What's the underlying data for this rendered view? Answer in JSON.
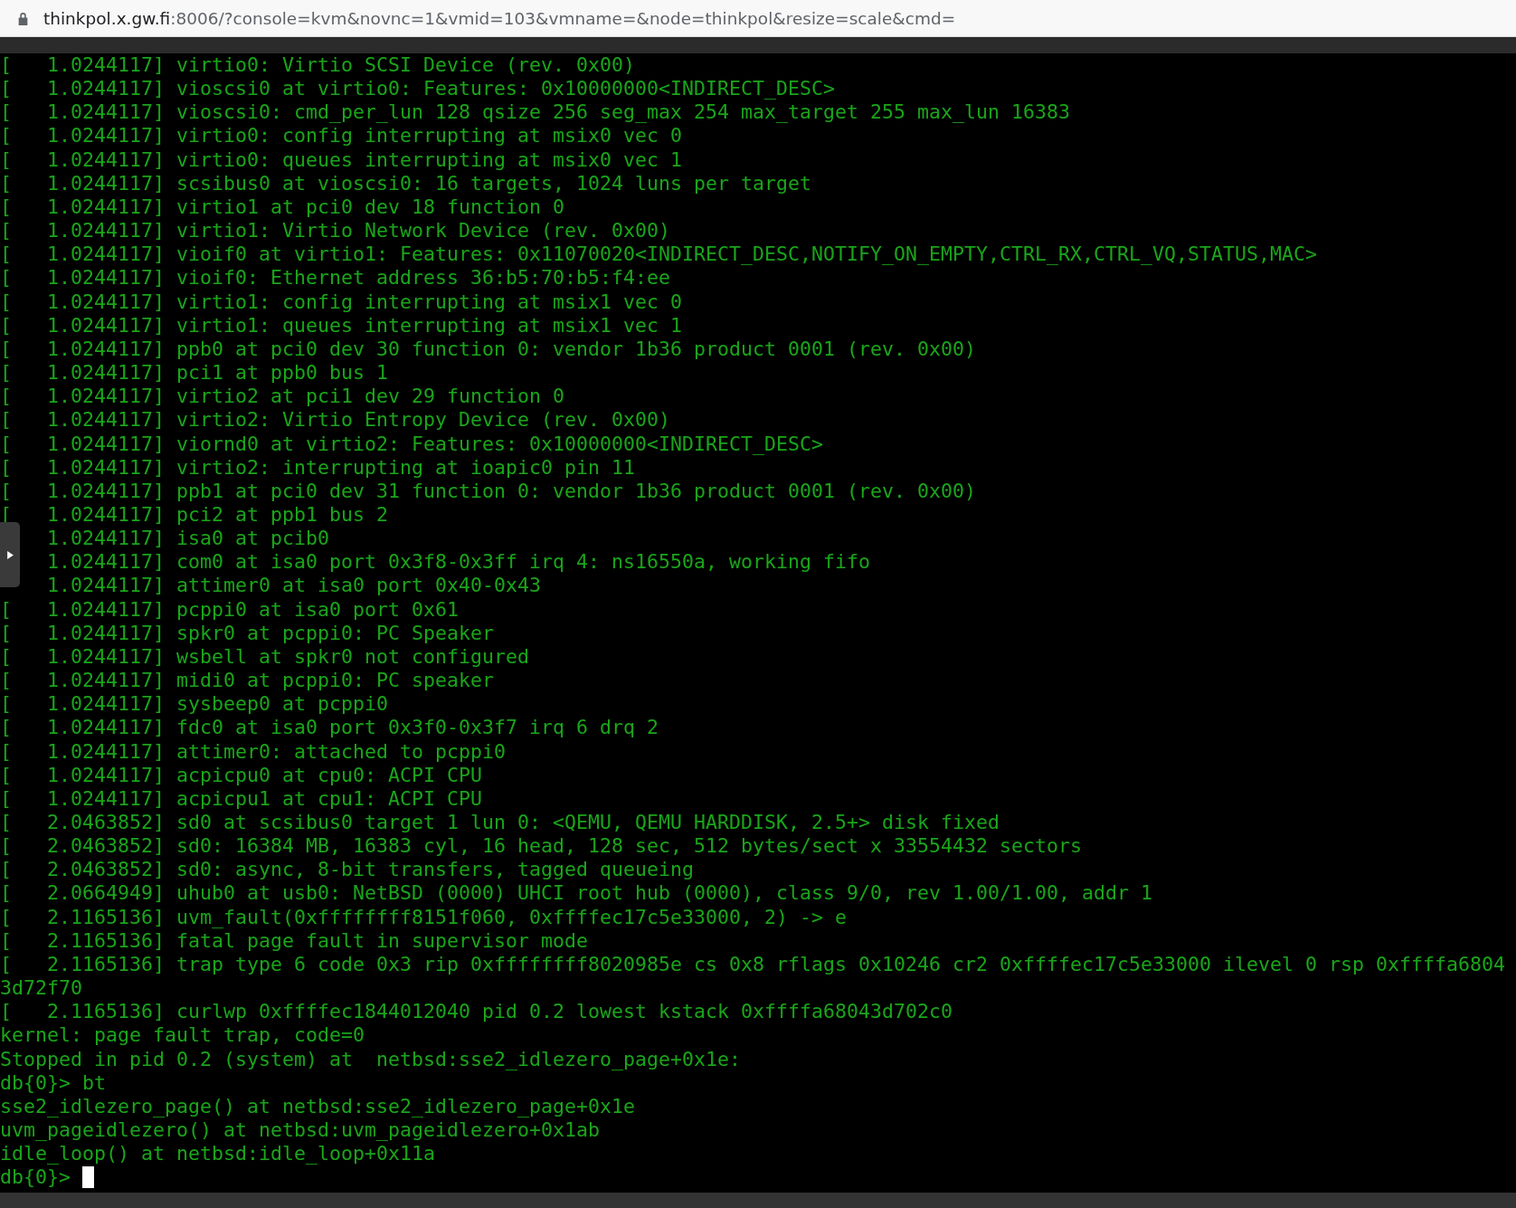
{
  "address_bar": {
    "host": "thinkpol.x.gw.fi",
    "path": ":8006/?console=kvm&novnc=1&vmid=103&vmname=&node=thinkpol&resize=scale&cmd="
  },
  "console": {
    "lines": [
      "[   1.0244117] virtio0: Virtio SCSI Device (rev. 0x00)",
      "[   1.0244117] vioscsi0 at virtio0: Features: 0x10000000<INDIRECT_DESC>",
      "[   1.0244117] vioscsi0: cmd_per_lun 128 qsize 256 seg_max 254 max_target 255 max_lun 16383",
      "[   1.0244117] virtio0: config interrupting at msix0 vec 0",
      "[   1.0244117] virtio0: queues interrupting at msix0 vec 1",
      "[   1.0244117] scsibus0 at vioscsi0: 16 targets, 1024 luns per target",
      "[   1.0244117] virtio1 at pci0 dev 18 function 0",
      "[   1.0244117] virtio1: Virtio Network Device (rev. 0x00)",
      "[   1.0244117] vioif0 at virtio1: Features: 0x11070020<INDIRECT_DESC,NOTIFY_ON_EMPTY,CTRL_RX,CTRL_VQ,STATUS,MAC>",
      "[   1.0244117] vioif0: Ethernet address 36:b5:70:b5:f4:ee",
      "[   1.0244117] virtio1: config interrupting at msix1 vec 0",
      "[   1.0244117] virtio1: queues interrupting at msix1 vec 1",
      "[   1.0244117] ppb0 at pci0 dev 30 function 0: vendor 1b36 product 0001 (rev. 0x00)",
      "[   1.0244117] pci1 at ppb0 bus 1",
      "[   1.0244117] virtio2 at pci1 dev 29 function 0",
      "[   1.0244117] virtio2: Virtio Entropy Device (rev. 0x00)",
      "[   1.0244117] viornd0 at virtio2: Features: 0x10000000<INDIRECT_DESC>",
      "[   1.0244117] virtio2: interrupting at ioapic0 pin 11",
      "[   1.0244117] ppb1 at pci0 dev 31 function 0: vendor 1b36 product 0001 (rev. 0x00)",
      "[   1.0244117] pci2 at ppb1 bus 2",
      "    1.0244117] isa0 at pcib0",
      "    1.0244117] com0 at isa0 port 0x3f8-0x3ff irq 4: ns16550a, working fifo",
      "    1.0244117] attimer0 at isa0 port 0x40-0x43",
      "[   1.0244117] pcppi0 at isa0 port 0x61",
      "[   1.0244117] spkr0 at pcppi0: PC Speaker",
      "[   1.0244117] wsbell at spkr0 not configured",
      "[   1.0244117] midi0 at pcppi0: PC speaker",
      "[   1.0244117] sysbeep0 at pcppi0",
      "[   1.0244117] fdc0 at isa0 port 0x3f0-0x3f7 irq 6 drq 2",
      "[   1.0244117] attimer0: attached to pcppi0",
      "[   1.0244117] acpicpu0 at cpu0: ACPI CPU",
      "[   1.0244117] acpicpu1 at cpu1: ACPI CPU",
      "[   2.0463852] sd0 at scsibus0 target 1 lun 0: <QEMU, QEMU HARDDISK, 2.5+> disk fixed",
      "[   2.0463852] sd0: 16384 MB, 16383 cyl, 16 head, 128 sec, 512 bytes/sect x 33554432 sectors",
      "[   2.0463852] sd0: async, 8-bit transfers, tagged queueing",
      "[   2.0664949] uhub0 at usb0: NetBSD (0000) UHCI root hub (0000), class 9/0, rev 1.00/1.00, addr 1",
      "[   2.1165136] uvm_fault(0xffffffff8151f060, 0xffffec17c5e33000, 2) -> e",
      "[   2.1165136] fatal page fault in supervisor mode",
      "[   2.1165136] trap type 6 code 0x3 rip 0xffffffff8020985e cs 0x8 rflags 0x10246 cr2 0xffffec17c5e33000 ilevel 0 rsp 0xffffa6804",
      "3d72f70",
      "[   2.1165136] curlwp 0xffffec1844012040 pid 0.2 lowest kstack 0xffffa68043d702c0",
      "kernel: page fault trap, code=0",
      "Stopped in pid 0.2 (system) at  netbsd:sse2_idlezero_page+0x1e:",
      "db{0}> bt",
      "sse2_idlezero_page() at netbsd:sse2_idlezero_page+0x1e",
      "uvm_pageidlezero() at netbsd:uvm_pageidlezero+0x1ab",
      "idle_loop() at netbsd:idle_loop+0x11a"
    ],
    "prompt": "db{0}> ",
    "cursor": true
  }
}
